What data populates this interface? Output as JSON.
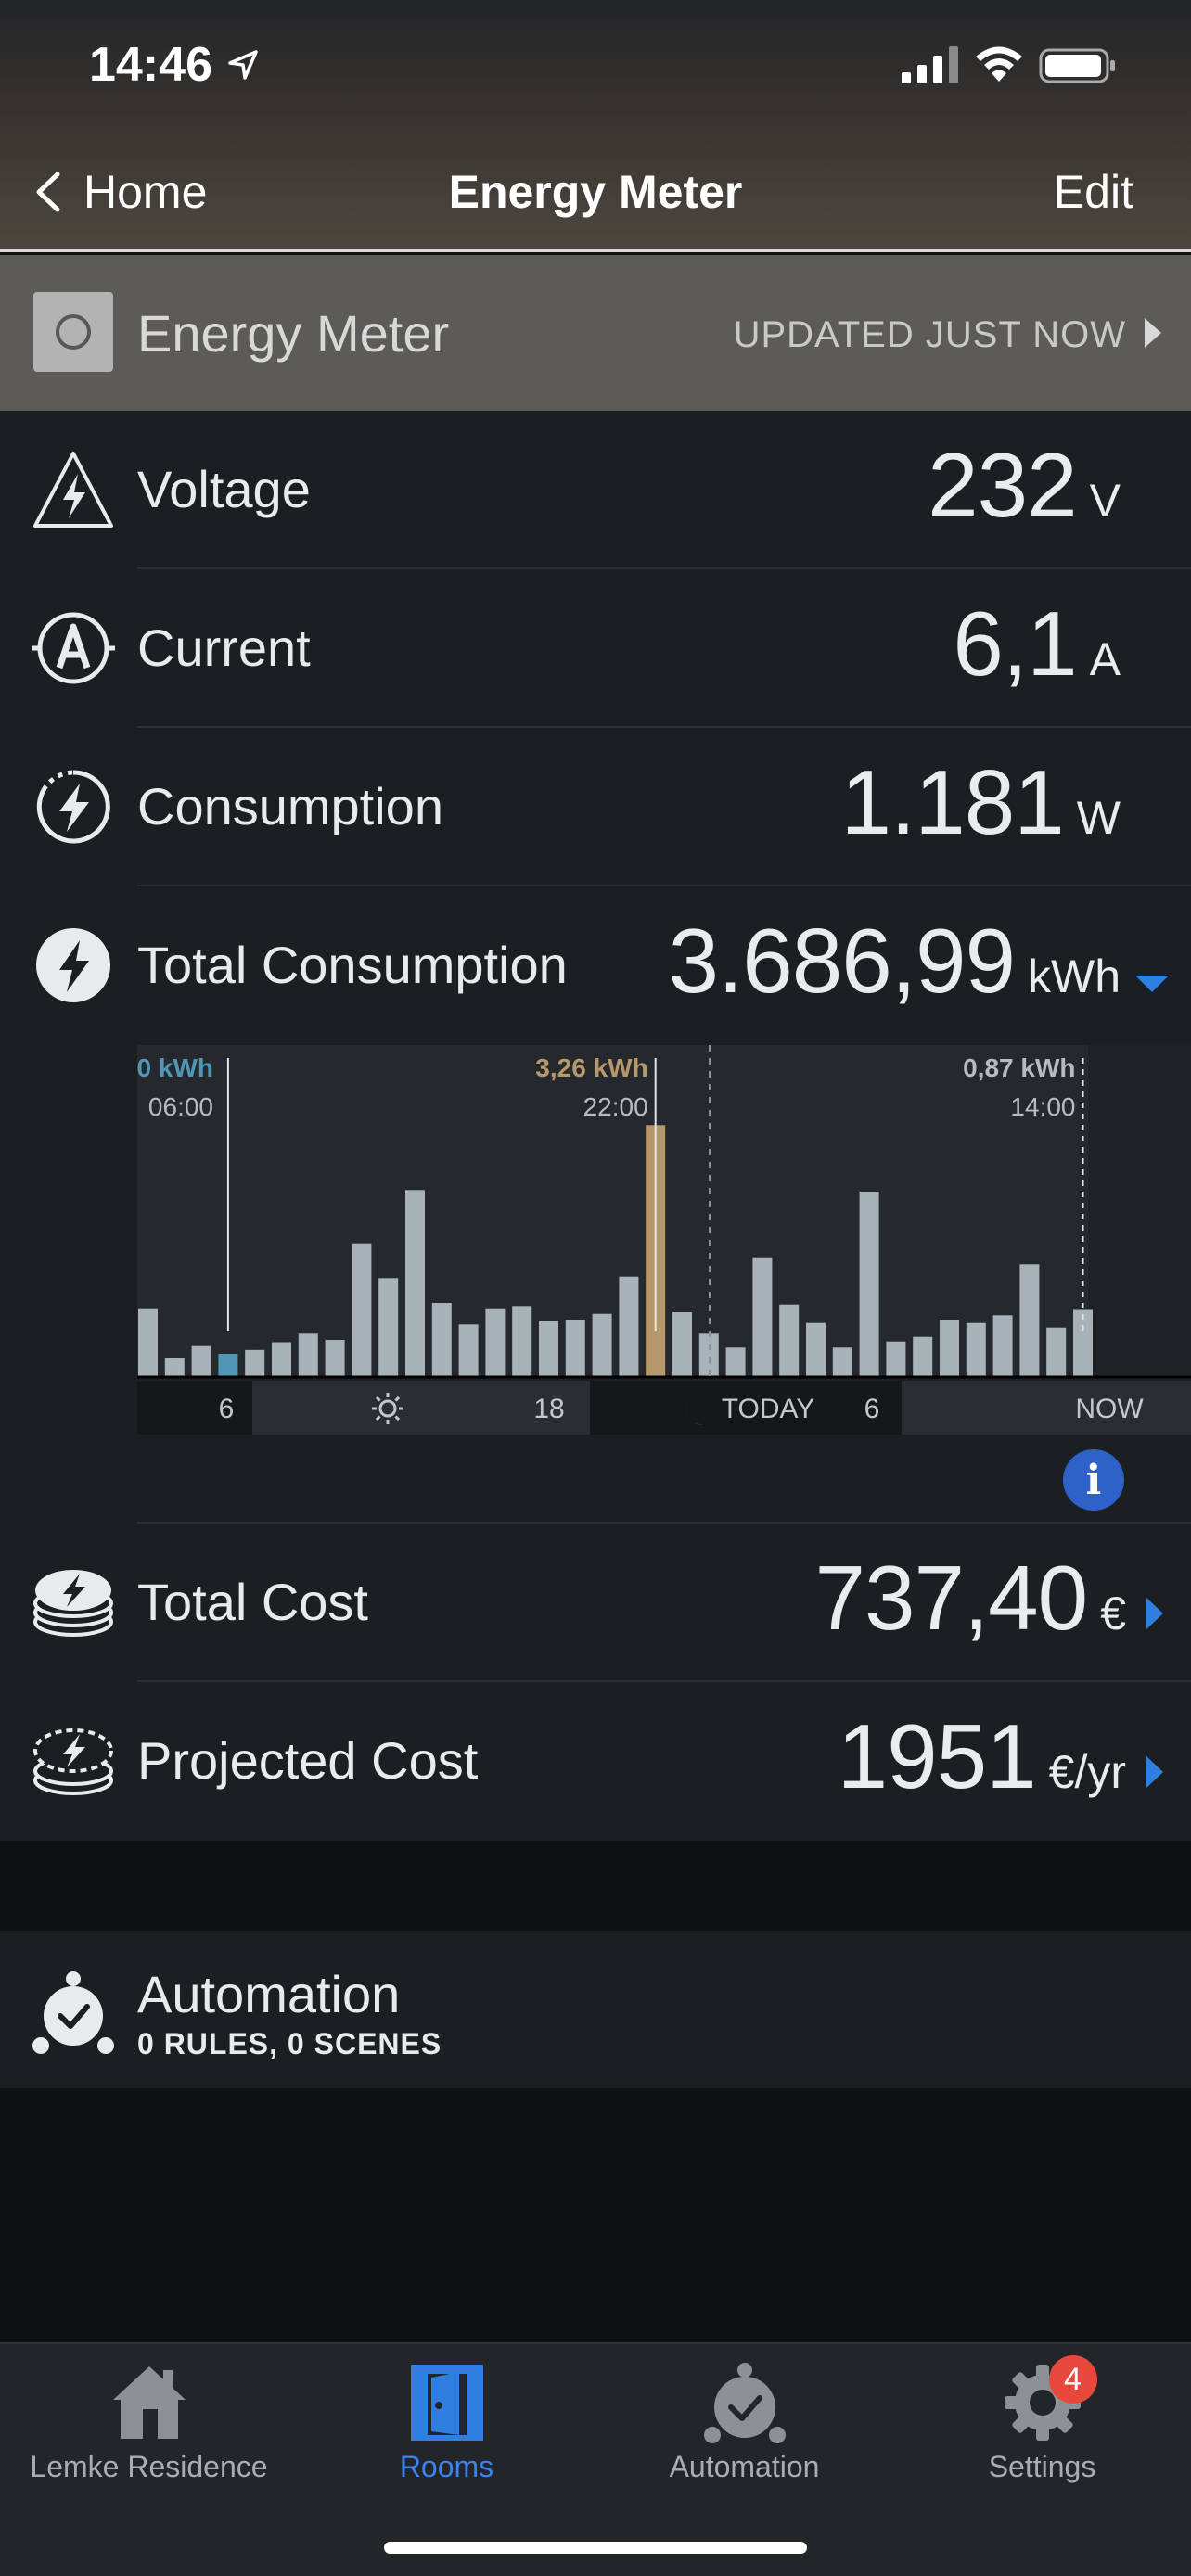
{
  "status": {
    "time": "14:46"
  },
  "nav": {
    "back_label": "Home",
    "title": "Energy Meter",
    "edit_label": "Edit"
  },
  "device": {
    "name": "Energy Meter",
    "updated": "UPDATED JUST NOW"
  },
  "metrics": [
    {
      "label": "Voltage",
      "value": "232",
      "unit": "V",
      "icon": "voltage-icon"
    },
    {
      "label": "Current",
      "value": "6,1",
      "unit": "A",
      "icon": "current-icon"
    },
    {
      "label": "Consumption",
      "value": "1.181",
      "unit": "W",
      "icon": "consumption-icon"
    },
    {
      "label": "Total Consumption",
      "value": "3.686,99",
      "unit": "kWh",
      "icon": "total-consumption-icon"
    }
  ],
  "chart_data": {
    "type": "bar",
    "values": [
      0.88,
      0.25,
      0.4,
      0.3,
      0.35,
      0.45,
      0.56,
      0.48,
      1.72,
      1.28,
      2.42,
      0.96,
      0.68,
      0.88,
      0.92,
      0.72,
      0.74,
      0.82,
      1.3,
      3.26,
      0.84,
      0.56,
      0.38,
      1.54,
      0.94,
      0.7,
      0.38,
      2.4,
      0.46,
      0.52,
      0.74,
      0.7,
      0.8,
      1.46,
      0.64,
      0.87
    ],
    "highlight_index": 19,
    "selected_index": 3,
    "annotations": [
      {
        "label": "0 kWh",
        "time": "06:00",
        "index": 3
      },
      {
        "label": "3,26 kWh",
        "time": "22:00",
        "index": 19
      },
      {
        "label": "0,87 kWh",
        "time": "14:00",
        "index": 35
      }
    ],
    "axis": {
      "segments": [
        {
          "label": "6",
          "type": "night"
        },
        {
          "label": "18",
          "type": "day"
        },
        {
          "label": "TODAY",
          "type": "night"
        },
        {
          "label": "6",
          "type": "day"
        },
        {
          "label": "NOW",
          "type": "day"
        }
      ]
    },
    "colors": {
      "bar": "#a8b3b9",
      "highlight": "#b6986a",
      "selected": "#4f97b4"
    }
  },
  "costs": [
    {
      "label": "Total Cost",
      "value": "737,40",
      "unit": "€",
      "icon": "coin-stack-icon"
    },
    {
      "label": "Projected Cost",
      "value": "1951",
      "unit": "€/yr",
      "icon": "projected-coin-stack-icon"
    }
  ],
  "automation": {
    "title": "Automation",
    "subtitle": "0 RULES, 0 SCENES"
  },
  "tabs": [
    {
      "label": "Lemke Residence",
      "icon": "house-icon"
    },
    {
      "label": "Rooms",
      "icon": "door-icon",
      "active": true
    },
    {
      "label": "Automation",
      "icon": "alarm-clock-icon"
    },
    {
      "label": "Settings",
      "icon": "gear-icon",
      "badge": "4"
    }
  ],
  "colors": {
    "accent": "#2f7fe0",
    "panel": "#1c1f22",
    "badge": "#e8483b"
  }
}
